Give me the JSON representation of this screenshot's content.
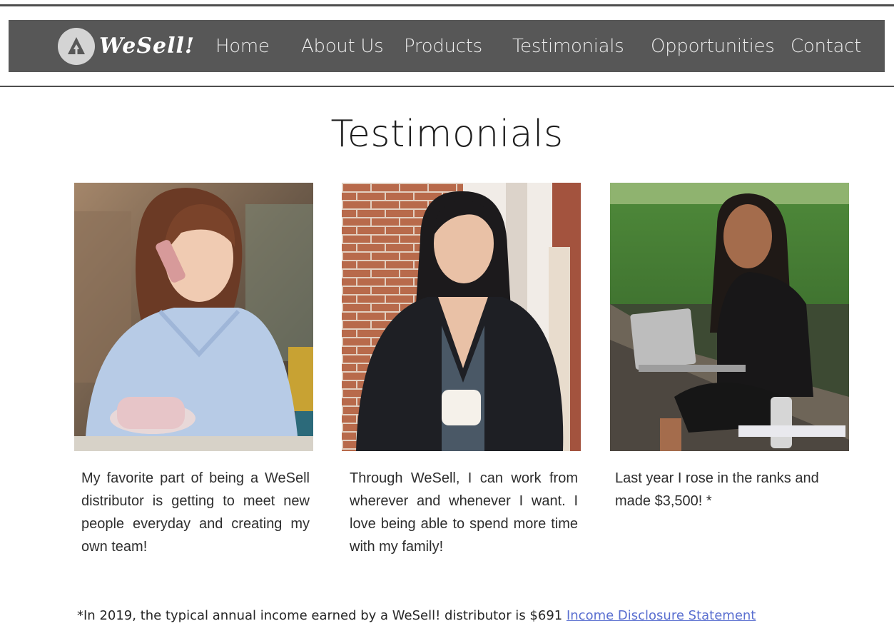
{
  "brand": {
    "name": "WeSell!",
    "logo_icon": "tree-icon"
  },
  "nav": {
    "items": [
      {
        "label": "Home"
      },
      {
        "label": "About Us"
      },
      {
        "label": "Products"
      },
      {
        "label": "Testimonials"
      },
      {
        "label": "Opportunities"
      },
      {
        "label": "Contact"
      }
    ]
  },
  "page": {
    "title": "Testimonials"
  },
  "testimonials": [
    {
      "photo": "woman-on-phone-with-coffee-cup",
      "quote": "My favorite part of being a WeSell distributor is getting to meet new people everyday and creating my own team!"
    },
    {
      "photo": "woman-holding-mug-by-brick-wall",
      "quote": "Through WeSell, I can work from wherever and whenever I want. I love being able to spend more time with my family!"
    },
    {
      "photo": "woman-with-laptop-outdoors",
      "quote": "Last year I rose in the ranks and made $3,500! *"
    }
  ],
  "footnote": {
    "text": "*In 2019, the typical annual income earned by a WeSell! distributor is $691 ",
    "link_label": "Income Disclosure Statement"
  },
  "colors": {
    "navbar": "#575757",
    "rule": "#4e4e4e",
    "link": "#5a6fd0",
    "text": "#2e2e2e"
  }
}
